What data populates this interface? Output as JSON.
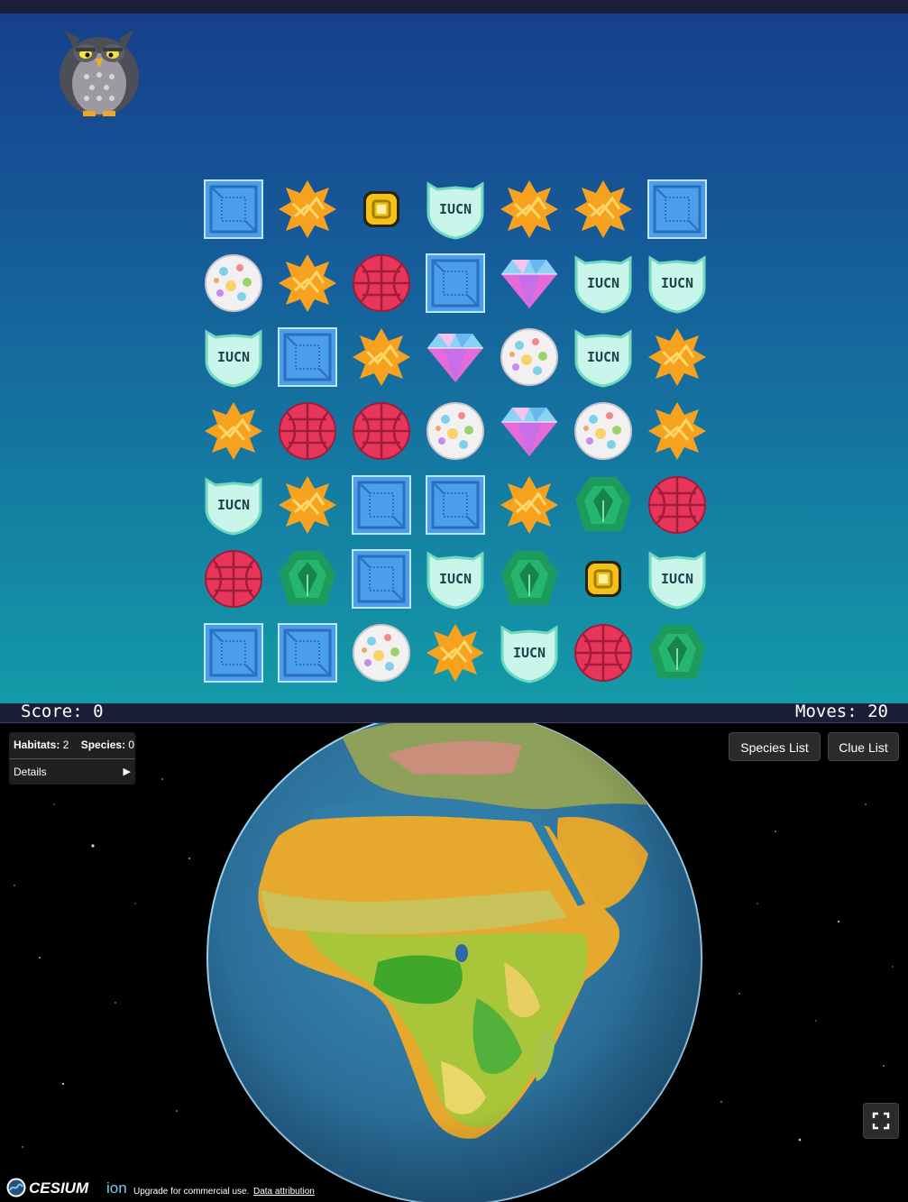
{
  "game": {
    "score_label": "Score: 0",
    "moves_label": "Moves: 20",
    "mascot_icon": "owl-icon",
    "board": [
      [
        "box",
        "star",
        "coin",
        "iucn",
        "star",
        "star",
        "box"
      ],
      [
        "egg",
        "star",
        "ball",
        "box",
        "gem",
        "iucn",
        "iucn"
      ],
      [
        "iucn",
        "box",
        "star",
        "gem",
        "egg",
        "iucn",
        "star"
      ],
      [
        "star",
        "ball",
        "ball",
        "egg",
        "gem",
        "egg",
        "star"
      ],
      [
        "iucn",
        "star",
        "box",
        "box",
        "star",
        "emerald",
        "ball"
      ],
      [
        "ball",
        "emerald",
        "box",
        "iucn",
        "emerald",
        "coin",
        "iucn"
      ],
      [
        "box",
        "box",
        "egg",
        "star",
        "iucn",
        "ball",
        "emerald"
      ]
    ],
    "badge_text": "IUCN"
  },
  "viewer": {
    "habitats_label": "Habitats:",
    "habitats_value": "2",
    "species_label": "Species:",
    "species_value": "0",
    "details_label": "Details",
    "details_arrow": "▶",
    "species_list_button": "Species List",
    "clue_list_button": "Clue List",
    "fullscreen_icon": "fullscreen-icon",
    "credits": {
      "logo_text": "CESIUM ion",
      "upgrade_text": "Upgrade for commercial use.",
      "attribution_link": "Data attribution"
    }
  },
  "colors": {
    "box": "#4a9eea",
    "star": "#f7a21e",
    "ball": "#e8365b",
    "gem": "#e66ad8",
    "emerald": "#1c9b5c",
    "iucn": "#c9f5ea",
    "coin": "#f2c218",
    "sky_top": "#173f8c",
    "sky_bottom": "#149aa8",
    "ocean": "#2f7eaa"
  }
}
